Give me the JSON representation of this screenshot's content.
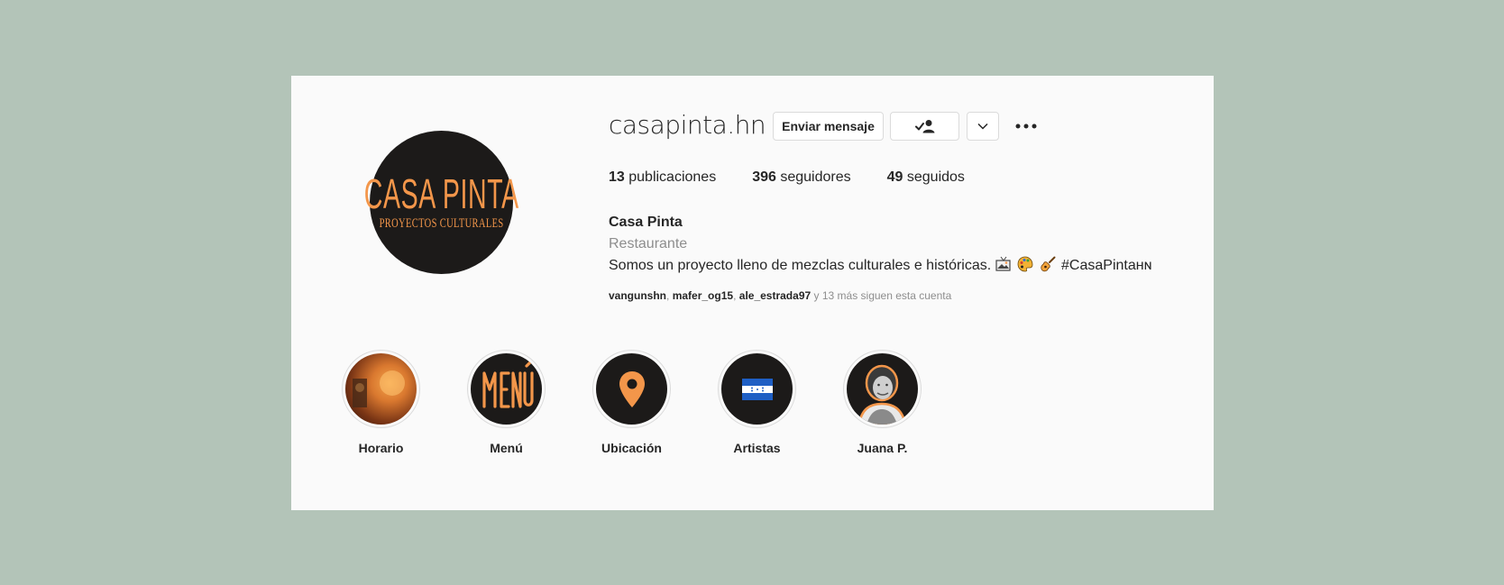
{
  "profile": {
    "avatar_title": "CASA PINTA",
    "avatar_subtitle": "PROYECTOS CULTURALES",
    "username": "casapinta.hn",
    "message_button": "Enviar mensaje",
    "follow_icon": "person-check-icon",
    "dropdown_icon": "chevron-down-icon",
    "more_icon": "more-options-icon"
  },
  "stats": {
    "posts_count": "13",
    "posts_label": " publicaciones",
    "followers_count": "396",
    "followers_label": " seguidores",
    "following_count": "49",
    "following_label": " seguidos"
  },
  "bio": {
    "name": "Casa Pinta",
    "category": "Restaurante",
    "text": "Somos un proyecto lleno de mezclas culturales e históricas.",
    "hashtag": "#CasaPintaʜɴ"
  },
  "followed_by": {
    "users": [
      "vangunshn",
      "mafer_og15",
      "ale_estrada97"
    ],
    "separator": ",",
    "suffix": " y 13 más siguen esta cuenta"
  },
  "highlights": [
    {
      "label": "Horario"
    },
    {
      "label": "Menú"
    },
    {
      "label": "Ubicación"
    },
    {
      "label": "Artistas"
    },
    {
      "label": "Juana P."
    }
  ],
  "colors": {
    "accent_orange": "#f3964a",
    "dark": "#1c1a19",
    "background": "#b3c4b8"
  }
}
